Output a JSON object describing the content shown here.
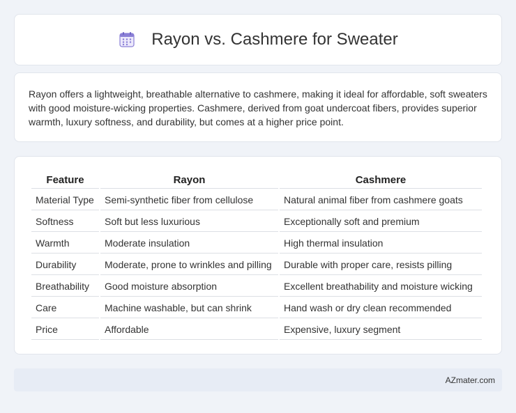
{
  "header": {
    "icon": "calendar-icon",
    "title": "Rayon vs. Cashmere for Sweater"
  },
  "summary": {
    "text": "Rayon offers a lightweight, breathable alternative to cashmere, making it ideal for affordable, soft sweaters with good moisture-wicking properties. Cashmere, derived from goat undercoat fibers, provides superior warmth, luxury softness, and durability, but comes at a higher price point."
  },
  "table": {
    "headers": [
      "Feature",
      "Rayon",
      "Cashmere"
    ],
    "rows": [
      [
        "Material Type",
        "Semi-synthetic fiber from cellulose",
        "Natural animal fiber from cashmere goats"
      ],
      [
        "Softness",
        "Soft but less luxurious",
        "Exceptionally soft and premium"
      ],
      [
        "Warmth",
        "Moderate insulation",
        "High thermal insulation"
      ],
      [
        "Durability",
        "Moderate, prone to wrinkles and pilling",
        "Durable with proper care, resists pilling"
      ],
      [
        "Breathability",
        "Good moisture absorption",
        "Excellent breathability and moisture wicking"
      ],
      [
        "Care",
        "Machine washable, but can shrink",
        "Hand wash or dry clean recommended"
      ],
      [
        "Price",
        "Affordable",
        "Expensive, luxury segment"
      ]
    ]
  },
  "footer": {
    "text": "AZmater.com"
  },
  "colors": {
    "background": "#f0f3f8",
    "card": "#ffffff",
    "footer": "#e7ecf5",
    "icon_accent": "#8a7fd6"
  }
}
